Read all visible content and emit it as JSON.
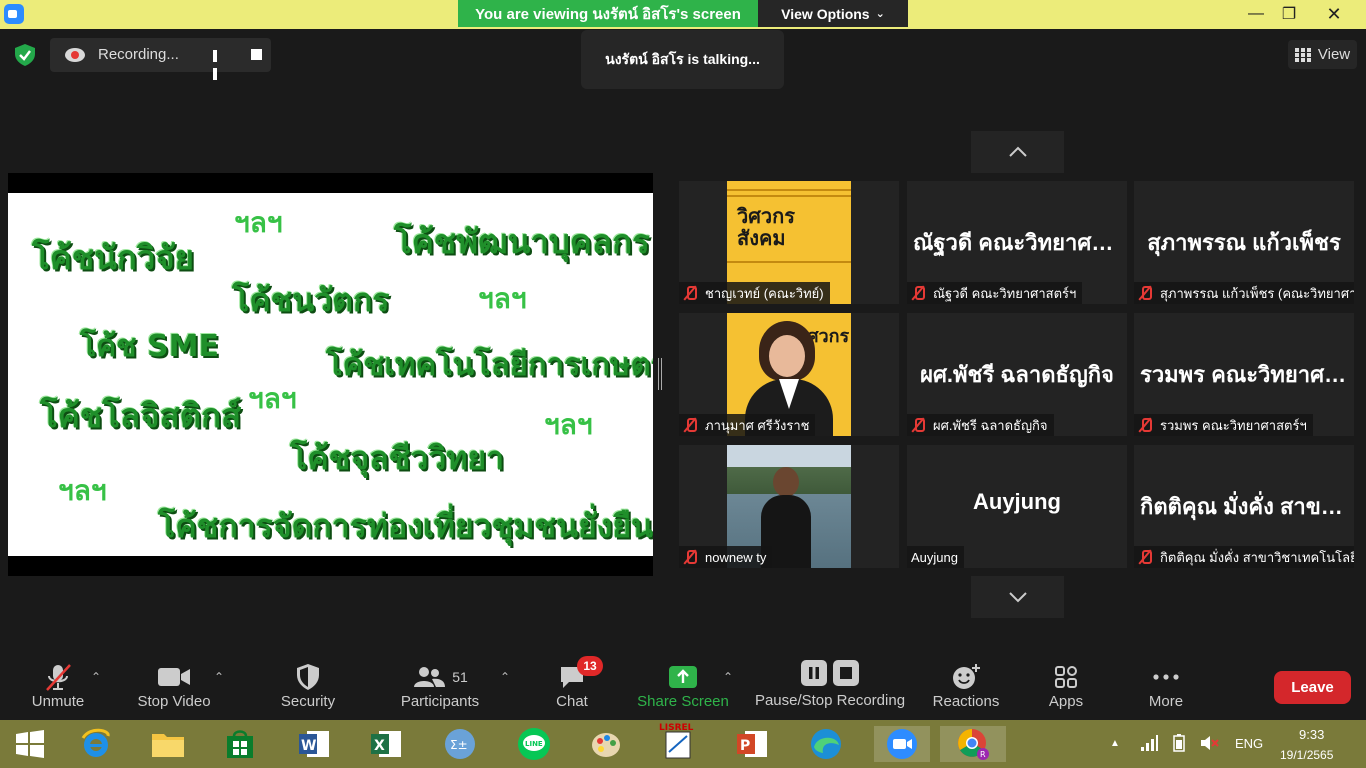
{
  "titlebar": {
    "banner": "You  are  viewing นงรัตน์ อิสโร's screen",
    "view_options": "View Options"
  },
  "recording": {
    "label": "Recording..."
  },
  "talking_indicator": "นงรัตน์ อิสโร is  talking...",
  "view_button": "View",
  "slide": {
    "phrases": [
      "โค้ชนักวิจัย",
      "โค้ชพัฒนาบุคลกร",
      "โค้ชนวัตกร",
      "โค้ช SME",
      "โค้ชเทคโนโลยีการเกษตร",
      "โค้ชโลจิสติกส์",
      "โค้ชจุลชีววิทยา",
      "โค้ชการจัดการท่องเที่ยวชุมชนยั่งยืน"
    ],
    "etc": "ฯลฯ"
  },
  "participants": [
    {
      "big_name": "",
      "label": "ชาญเวทย์ (คณะวิทย์)",
      "poster_text": "วิศวกร สังคม"
    },
    {
      "big_name": "ณัฐวดี คณะวิทยาศาสตร์ฯ",
      "label": "ณัฐวดี คณะวิทยาศาสตร์ฯ"
    },
    {
      "big_name": "สุภาพรรณ แก้วเพ็ชร",
      "label": "สุภาพรรณ แก้วเพ็ชร (คณะวิทยาศาสตร์ฯ)"
    },
    {
      "big_name": "",
      "label": "ภานุมาศ ศรีวังราช",
      "poster_text": "วิศวกร"
    },
    {
      "big_name": "ผศ.พัชรี  ฉลาดธัญกิจ",
      "label": "ผศ.พัชรี  ฉลาดธัญกิจ"
    },
    {
      "big_name": "รวมพร  คณะวิทยาศาสตร์ฯ",
      "label": "รวมพร  คณะวิทยาศาสตร์ฯ"
    },
    {
      "big_name": "",
      "label": "nownew ty"
    },
    {
      "big_name": "Auyjung",
      "label": "Auyjung"
    },
    {
      "big_name": "กิตติคุณ  มั่งคั่ง สาขาวิชาเทคโนโลยี",
      "label": "กิตติคุณ  มั่งคั่ง สาขาวิชาเทคโนโลยี"
    }
  ],
  "toolbar": {
    "unmute": "Unmute",
    "stop_video": "Stop Video",
    "security": "Security",
    "participants": "Participants",
    "participants_count": "51",
    "chat": "Chat",
    "chat_badge": "13",
    "share_screen": "Share Screen",
    "pause_stop_recording": "Pause/Stop Recording",
    "reactions": "Reactions",
    "apps": "Apps",
    "more": "More",
    "leave": "Leave"
  },
  "taskbar": {
    "lang": "ENG",
    "time": "9:33",
    "date": "19/1/2565"
  },
  "colors": {
    "share_green": "#2fb34a",
    "leave_red": "#d4272b",
    "muted_red": "#e53935",
    "title_yellow": "#ecec7a"
  }
}
